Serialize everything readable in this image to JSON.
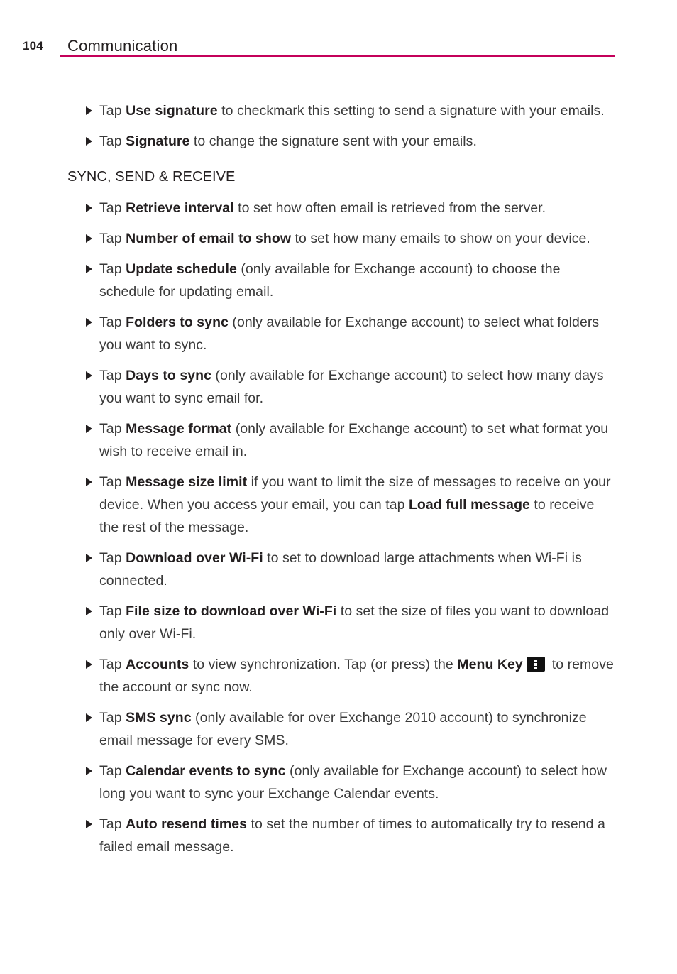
{
  "header": {
    "page_number": "104",
    "chapter_title": "Communication",
    "rule_color": "#c4005a"
  },
  "colors": {
    "accent": "#c4005a",
    "body_text": "#3a3a3a",
    "bold_text": "#231f20",
    "page_background": "#ffffff",
    "menu_key_background": "#111111",
    "menu_key_dots": "#ffffff"
  },
  "icons": {
    "bullet": "triangle-right-icon",
    "menu_key": "menu-key-icon"
  },
  "content": {
    "intro_bullets": [
      {
        "segments": [
          {
            "text": "Tap ",
            "bold": false
          },
          {
            "text": "Use signature",
            "bold": true
          },
          {
            "text": " to checkmark this setting to send a signature with your emails.",
            "bold": false
          }
        ]
      },
      {
        "segments": [
          {
            "text": "Tap ",
            "bold": false
          },
          {
            "text": "Signature",
            "bold": true
          },
          {
            "text": " to change the signature sent with your emails.",
            "bold": false
          }
        ]
      }
    ],
    "section_heading": "SYNC, SEND & RECEIVE",
    "section_bullets": [
      {
        "segments": [
          {
            "text": "Tap ",
            "bold": false
          },
          {
            "text": "Retrieve interval",
            "bold": true
          },
          {
            "text": " to set how often email is retrieved from the server.",
            "bold": false
          }
        ]
      },
      {
        "segments": [
          {
            "text": "Tap ",
            "bold": false
          },
          {
            "text": "Number of email to show",
            "bold": true
          },
          {
            "text": " to set how many emails to show on your device.",
            "bold": false
          }
        ]
      },
      {
        "segments": [
          {
            "text": "Tap ",
            "bold": false
          },
          {
            "text": "Update schedule",
            "bold": true
          },
          {
            "text": " (only available for Exchange account) to choose the schedule for updating email.",
            "bold": false
          }
        ]
      },
      {
        "segments": [
          {
            "text": "Tap ",
            "bold": false
          },
          {
            "text": "Folders to sync",
            "bold": true
          },
          {
            "text": " (only available for Exchange account) to select what folders you want to sync.",
            "bold": false
          }
        ]
      },
      {
        "segments": [
          {
            "text": "Tap ",
            "bold": false
          },
          {
            "text": "Days to sync",
            "bold": true
          },
          {
            "text": " (only available for Exchange account) to select how many days you want to sync email for.",
            "bold": false
          }
        ]
      },
      {
        "segments": [
          {
            "text": "Tap ",
            "bold": false
          },
          {
            "text": "Message format",
            "bold": true
          },
          {
            "text": " (only available for Exchange account) to set what format you wish to receive email in.",
            "bold": false
          }
        ]
      },
      {
        "segments": [
          {
            "text": "Tap ",
            "bold": false
          },
          {
            "text": "Message size limit",
            "bold": true
          },
          {
            "text": " if you want to limit the size of messages to receive on your device. When you access your email, you can tap ",
            "bold": false
          },
          {
            "text": "Load full message",
            "bold": true
          },
          {
            "text": " to receive the rest of the message.",
            "bold": false
          }
        ]
      },
      {
        "segments": [
          {
            "text": "Tap ",
            "bold": false
          },
          {
            "text": "Download over Wi-Fi",
            "bold": true
          },
          {
            "text": " to set to download large attachments when Wi-Fi is connected.",
            "bold": false
          }
        ]
      },
      {
        "segments": [
          {
            "text": "Tap ",
            "bold": false
          },
          {
            "text": "File size to download over Wi-Fi",
            "bold": true
          },
          {
            "text": " to set the size of files you want to download only over Wi-Fi.",
            "bold": false
          }
        ]
      },
      {
        "segments": [
          {
            "text": "Tap ",
            "bold": false
          },
          {
            "text": "Accounts",
            "bold": true
          },
          {
            "text": " to view synchronization. Tap (or press) the ",
            "bold": false
          },
          {
            "text": "Menu Key",
            "bold": true
          },
          {
            "text": " ",
            "bold": false
          },
          {
            "icon": "menu-key-icon"
          },
          {
            "text": " to remove the account or sync now.",
            "bold": false
          }
        ]
      },
      {
        "segments": [
          {
            "text": "Tap ",
            "bold": false
          },
          {
            "text": "SMS sync",
            "bold": true
          },
          {
            "text": " (only available for over Exchange 2010 account) to synchronize email message for every SMS.",
            "bold": false
          }
        ]
      },
      {
        "segments": [
          {
            "text": "Tap ",
            "bold": false
          },
          {
            "text": "Calendar events to sync",
            "bold": true
          },
          {
            "text": " (only available for Exchange account) to select how long you want to sync your Exchange Calendar events.",
            "bold": false
          }
        ]
      },
      {
        "segments": [
          {
            "text": "Tap ",
            "bold": false
          },
          {
            "text": "Auto resend times",
            "bold": true
          },
          {
            "text": " to set the number of times to automatically try to resend a failed email message.",
            "bold": false
          }
        ]
      }
    ]
  }
}
